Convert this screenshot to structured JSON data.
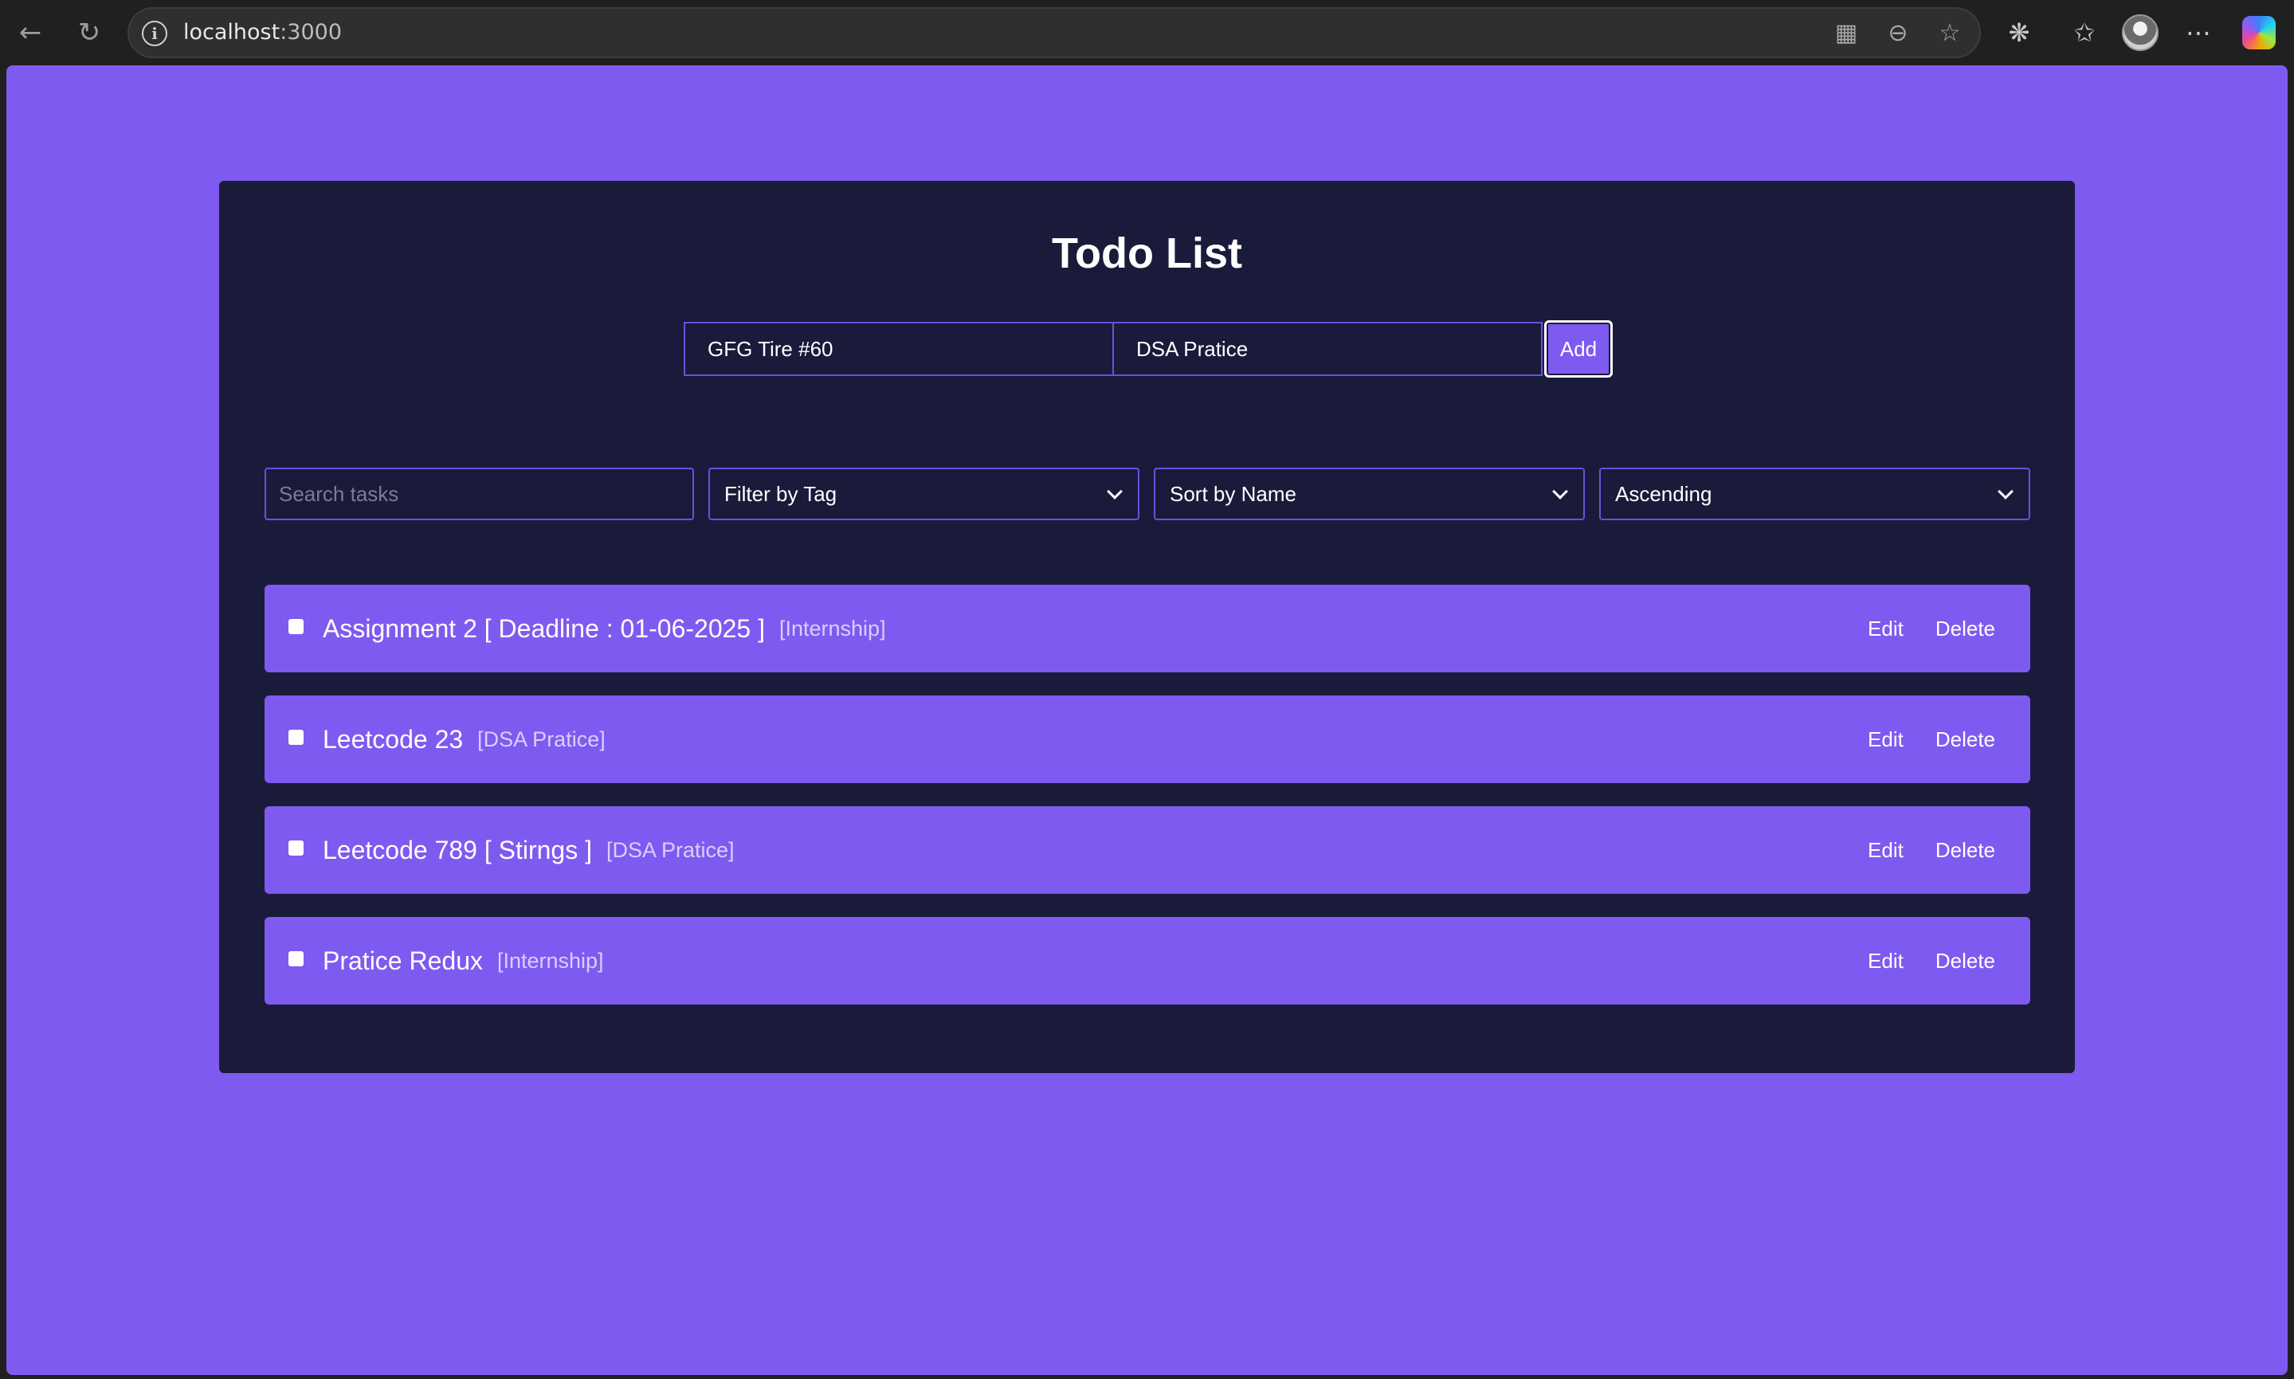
{
  "browser": {
    "url_host": "localhost",
    "url_port": ":3000",
    "icons": {
      "back": "back-arrow-icon",
      "refresh": "refresh-icon",
      "info": "info-icon",
      "apps": "app-grid-icon",
      "zoom": "zoom-out-icon",
      "favorite": "star-icon",
      "extensions": "puzzle-icon",
      "favorites": "favorites-icon",
      "more": "more-icon"
    }
  },
  "app": {
    "title": "Todo List",
    "new_task": {
      "name_value": "GFG Tire #60",
      "tag_value": "DSA Pratice",
      "add_label": "Add"
    },
    "controls": {
      "search_placeholder": "Search tasks",
      "filter_value": "Filter by Tag",
      "sort_value": "Sort by Name",
      "order_value": "Ascending"
    },
    "tasks": [
      {
        "text": "Assignment 2 [ Deadline : 01-06-2025 ]",
        "tag": "[Internship]",
        "edit": "Edit",
        "delete": "Delete"
      },
      {
        "text": "Leetcode 23",
        "tag": "[DSA Pratice]",
        "edit": "Edit",
        "delete": "Delete"
      },
      {
        "text": "Leetcode 789 [ Stirngs ]",
        "tag": "[DSA Pratice]",
        "edit": "Edit",
        "delete": "Delete"
      },
      {
        "text": "Pratice Redux",
        "tag": "[Internship]",
        "edit": "Edit",
        "delete": "Delete"
      }
    ]
  },
  "colors": {
    "page_bg": "#7f5af0",
    "panel_bg": "#1a1b3a",
    "task_bg": "#7f5af0",
    "border": "#6b4fe0"
  }
}
